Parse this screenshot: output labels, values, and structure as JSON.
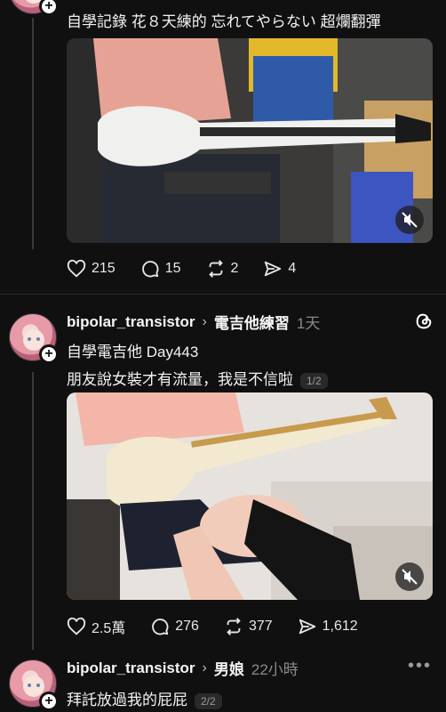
{
  "post1": {
    "text": "自學記錄 花８天練的 忘れてやらない 超爛翻彈",
    "likes": "215",
    "comments": "15",
    "reposts": "2",
    "shares": "4"
  },
  "post2": {
    "username": "bipolar_transistor",
    "topic": "電吉他練習",
    "time": "1天",
    "line1": "自學電吉他 Day443",
    "line2": "朋友說女裝才有流量，我是不信啦",
    "page": "1/2",
    "likes": "2.5萬",
    "comments": "276",
    "reposts": "377",
    "shares": "1,612"
  },
  "post3": {
    "username": "bipolar_transistor",
    "topic": "男娘",
    "time": "22小時",
    "text": "拜託放過我的屁屁",
    "page": "2/2"
  },
  "icons": {
    "like": "heart-icon",
    "comment": "comment-icon",
    "repost": "repost-icon",
    "share": "share-icon",
    "mute": "muted-speaker-icon",
    "threads": "threads-logo-icon",
    "more": "more-icon"
  }
}
